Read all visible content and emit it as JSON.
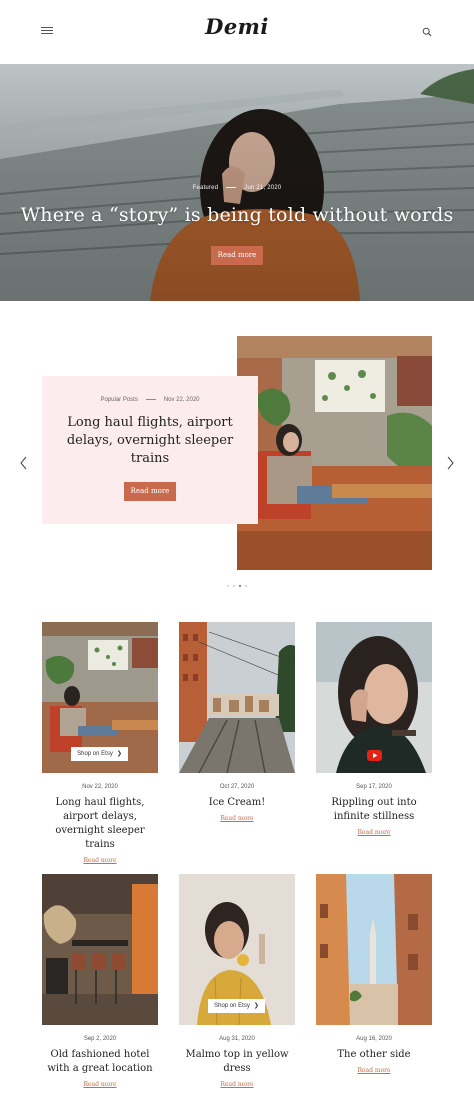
{
  "header": {
    "logo": "Demi",
    "menu_icon": "hamburger-menu-icon",
    "search_icon": "search-icon"
  },
  "hero": {
    "category": "Featured",
    "date": "Jun 21, 2020",
    "title": "Where a “story” is being told without words",
    "button_label": "Read more"
  },
  "slider": {
    "category": "Popular Posts",
    "date": "Nov 22, 2020",
    "title": "Long haul flights, airport delays, overnight sleeper trains",
    "button_label": "Read more",
    "prev_icon": "chevron-left-icon",
    "next_icon": "chevron-right-icon",
    "dots_count": 3,
    "active_dot": 2
  },
  "posts": [
    {
      "date": "Nov 22, 2020",
      "title": "Long haul flights, airport delays, overnight sleeper trains",
      "read_more": "Read more",
      "shop_label": "Shop on Etsy"
    },
    {
      "date": "Oct 27, 2020",
      "title": "Ice Cream!",
      "read_more": "Read more"
    },
    {
      "date": "Sep 17, 2020",
      "title": "Rippling out into infinite stillness",
      "read_more": "Read more",
      "video_icon": "youtube-play-icon"
    },
    {
      "date": "Sep 2, 2020",
      "title": "Old fashioned hotel with a great location",
      "read_more": "Read more"
    },
    {
      "date": "Aug 31, 2020",
      "title": "Malmo top in yellow dress",
      "read_more": "Read more",
      "shop_label": "Shop on Etsy"
    },
    {
      "date": "Aug 16, 2020",
      "title": "The other side",
      "read_more": "Read more"
    }
  ],
  "colors": {
    "accent": "#c9694e",
    "card_pink": "#fceced",
    "text_dark": "#222222"
  }
}
